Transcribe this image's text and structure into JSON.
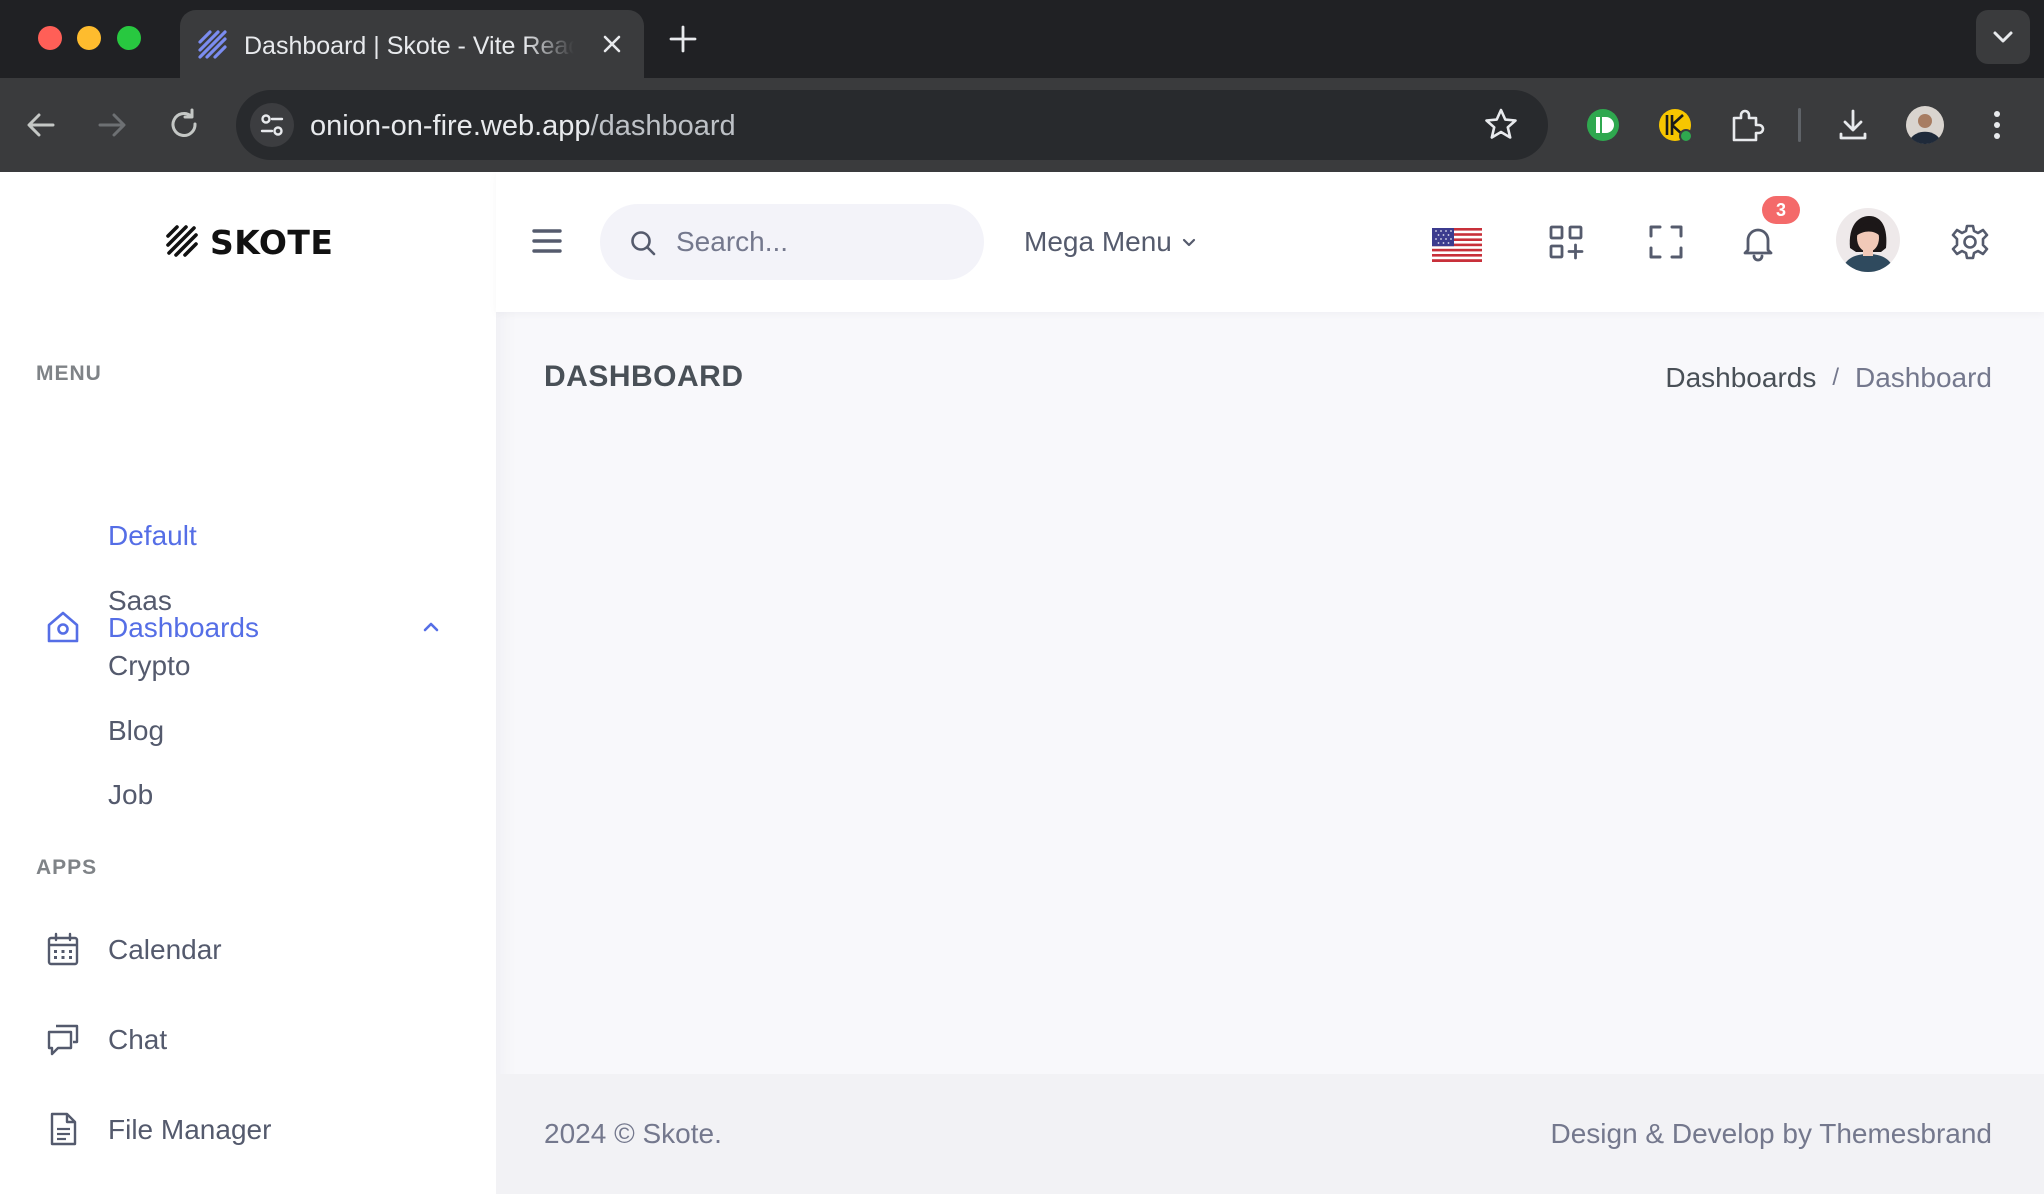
{
  "browser": {
    "tab_title": "Dashboard | Skote - Vite React",
    "url_host": "onion-on-fire.web.app",
    "url_path": "/dashboard"
  },
  "app": {
    "logo_text": "SKOTE",
    "brand_color": "#556ee6"
  },
  "sidebar": {
    "menu_title": "MENU",
    "dashboards_label": "Dashboards",
    "sub_items": [
      "Default",
      "Saas",
      "Crypto",
      "Blog",
      "Job"
    ],
    "apps_title": "APPS",
    "apps": [
      {
        "label": "Calendar",
        "icon": "calendar-icon"
      },
      {
        "label": "Chat",
        "icon": "chat-icon"
      },
      {
        "label": "File Manager",
        "icon": "file-icon"
      }
    ]
  },
  "topbar": {
    "search_placeholder": "Search...",
    "mega_menu_label": "Mega Menu",
    "notification_count": "3"
  },
  "main": {
    "page_title": "DASHBOARD",
    "breadcrumb": [
      "Dashboards",
      "Dashboard"
    ]
  },
  "footer": {
    "left": "2024 © Skote.",
    "right": "Design & Develop by Themesbrand"
  }
}
